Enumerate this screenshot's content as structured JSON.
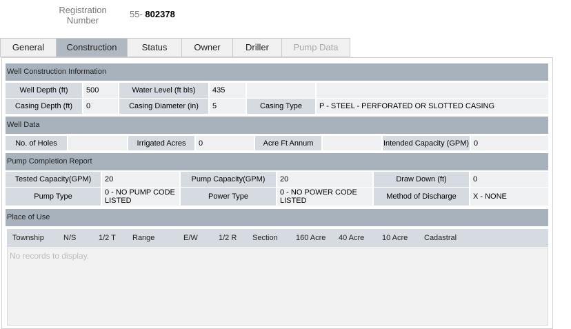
{
  "registration": {
    "label": "Registration Number",
    "prefix": "55-",
    "number": "802378"
  },
  "tabs": [
    {
      "label": "General"
    },
    {
      "label": "Construction"
    },
    {
      "label": "Status"
    },
    {
      "label": "Owner"
    },
    {
      "label": "Driller"
    },
    {
      "label": "Pump Data"
    }
  ],
  "well_construction": {
    "title": "Well Construction Information",
    "well_depth_label": "Well Depth (ft)",
    "well_depth": "500",
    "water_level_label": "Water Level (ft bls)",
    "water_level": "435",
    "casing_depth_label": "Casing Depth (ft)",
    "casing_depth": "0",
    "casing_diameter_label": "Casing Diameter (in)",
    "casing_diameter": "5",
    "casing_type_label": "Casing Type",
    "casing_type": "P - STEEL - PERFORATED OR SLOTTED CASING"
  },
  "well_data": {
    "title": "Well Data",
    "holes_label": "No. of Holes",
    "holes": "",
    "irrigated_label": "Irrigated Acres",
    "irrigated": "0",
    "acre_ft_label": "Acre Ft Annum",
    "acre_ft": "",
    "capacity_label": "Intended Capacity (GPM)",
    "capacity": "0"
  },
  "pump_completion": {
    "title": "Pump Completion Report",
    "tested_label": "Tested Capacity(GPM)",
    "tested": "20",
    "pump_cap_label": "Pump Capacity(GPM)",
    "pump_cap": "20",
    "draw_label": "Draw Down (ft)",
    "draw": "0",
    "pump_type_label": "Pump Type",
    "pump_type": "0 - NO PUMP CODE LISTED",
    "power_type_label": "Power Type",
    "power_type": "0 - NO POWER CODE LISTED",
    "discharge_label": "Method of Discharge",
    "discharge": "X - NONE"
  },
  "place_of_use": {
    "title": "Place of Use",
    "columns": [
      "Township",
      "N/S",
      "1/2 T",
      "Range",
      "E/W",
      "1/2 R",
      "Section",
      "160 Acre",
      "40 Acre",
      "10 Acre",
      "Cadastral"
    ],
    "empty_text": "No records to display."
  }
}
